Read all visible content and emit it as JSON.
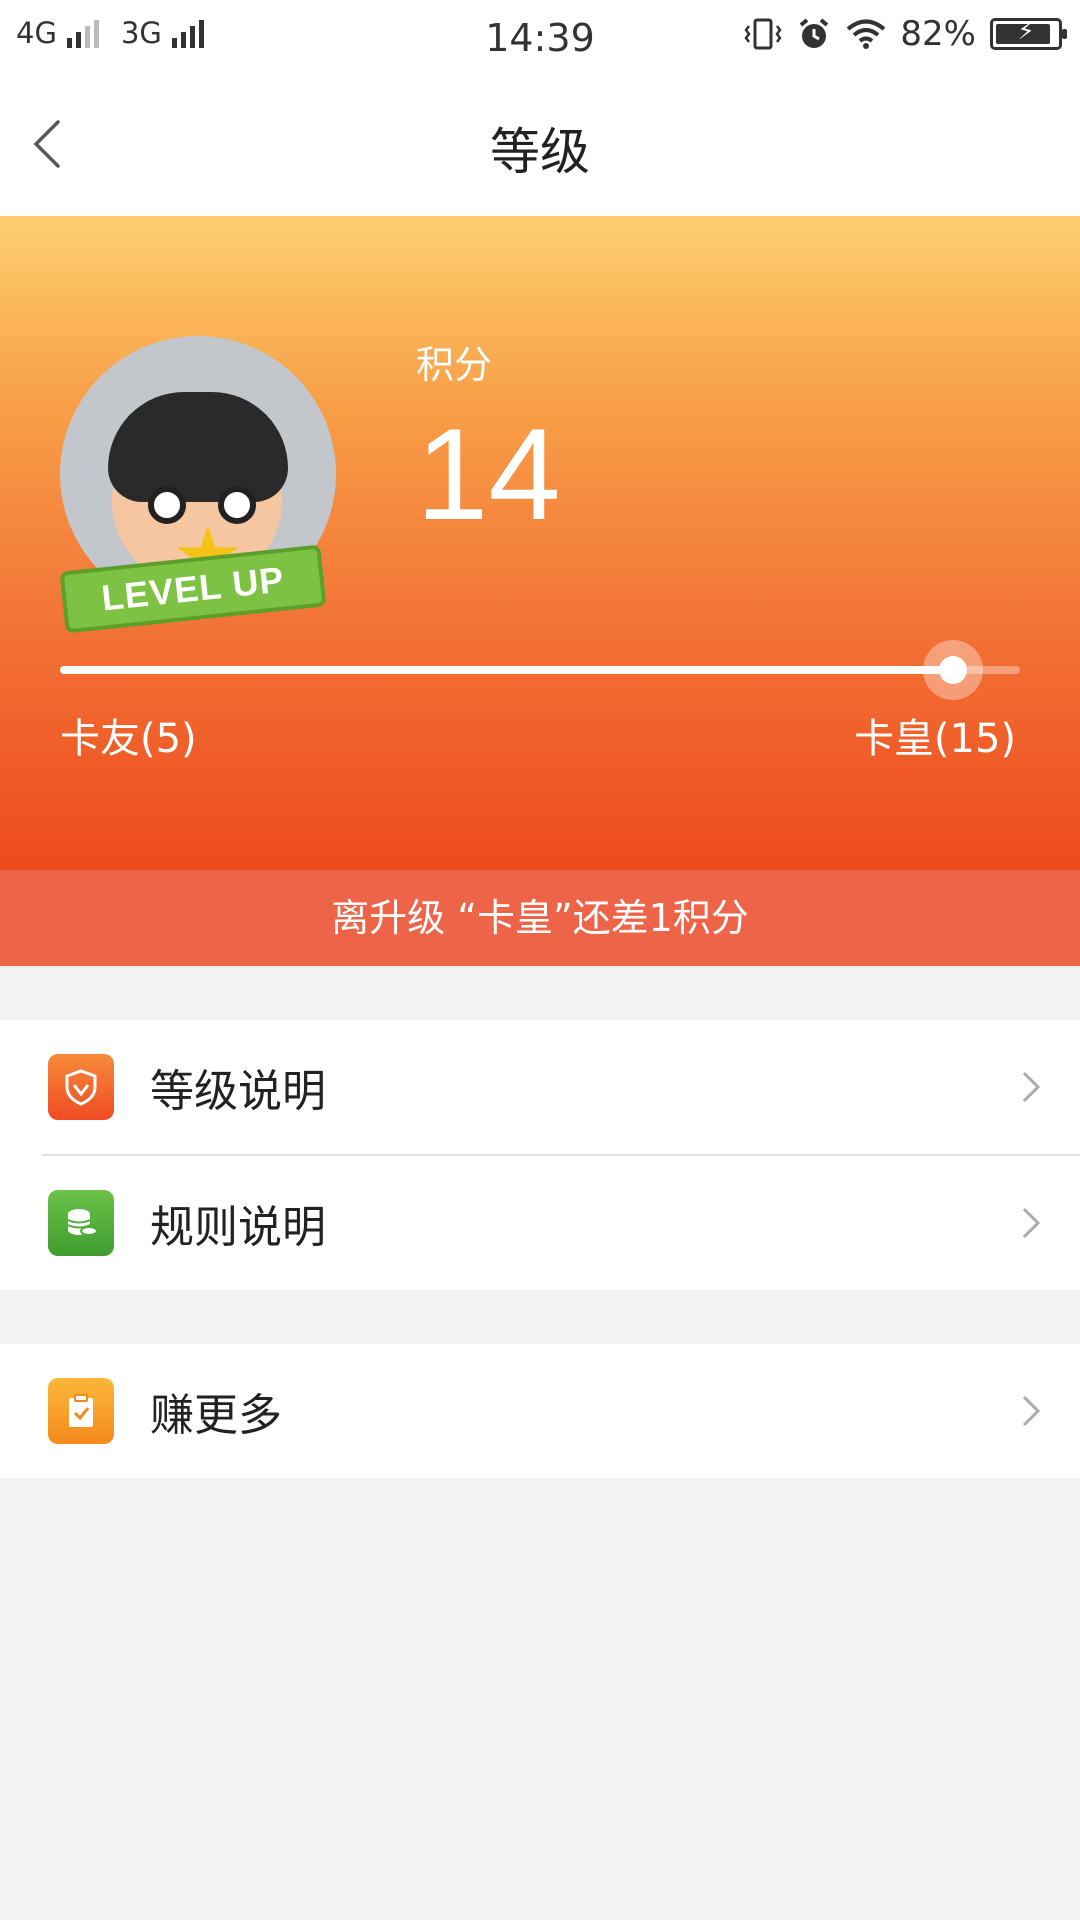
{
  "status_bar": {
    "net1": "4G",
    "net2": "3G",
    "time": "14:39",
    "battery": "82%"
  },
  "nav": {
    "title": "等级"
  },
  "hero": {
    "badge_text": "LEVEL UP",
    "points_label": "积分",
    "points_value": "14",
    "progress_fraction": 0.93,
    "level_current": "卡友(5)",
    "level_next": "卡皇(15)"
  },
  "banner": {
    "text": "离升级 “卡皇”还差1积分"
  },
  "menu": {
    "items": [
      {
        "label": "等级说明",
        "icon": "shield-icon",
        "color": "#f25a2a"
      },
      {
        "label": "规则说明",
        "icon": "coins-icon",
        "color": "#4fae3a"
      },
      {
        "label": "赚更多",
        "icon": "clipboard-check-icon",
        "color": "#f7a11f"
      }
    ]
  }
}
